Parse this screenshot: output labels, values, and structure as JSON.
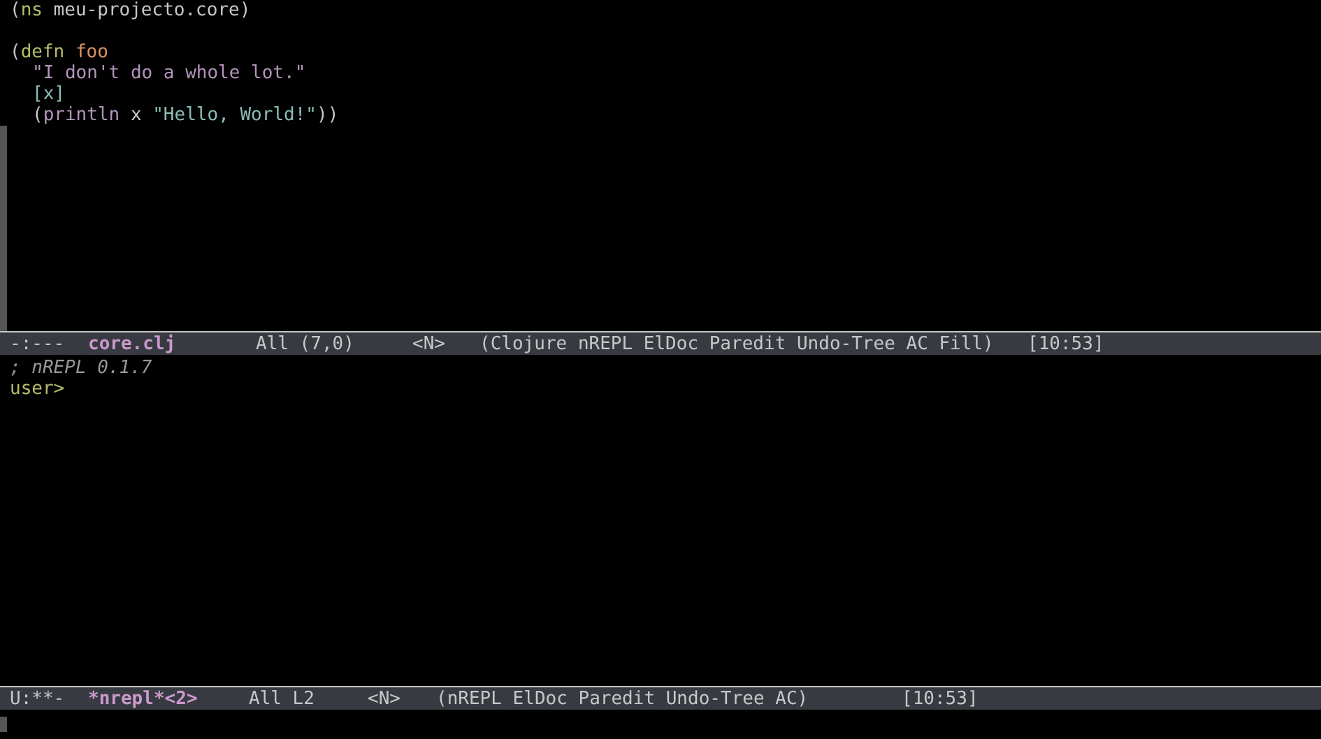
{
  "editor_window": {
    "lines": [
      {
        "indented": false,
        "blank_before": false,
        "tokens": [
          {
            "kind": "paren",
            "text": "("
          },
          {
            "kind": "keyword",
            "text": "ns"
          },
          {
            "kind": "plain",
            "text": " meu-projecto.core"
          },
          {
            "kind": "paren",
            "text": ")"
          }
        ]
      },
      {
        "indented": false,
        "blank_before": true,
        "tokens": [
          {
            "kind": "paren",
            "text": "("
          },
          {
            "kind": "keyword",
            "text": "defn"
          },
          {
            "kind": "name",
            "text": " foo"
          }
        ]
      },
      {
        "indented": true,
        "blank_before": false,
        "tokens": [
          {
            "kind": "docstring",
            "text": "\"I don't do a whole lot.\""
          }
        ]
      },
      {
        "indented": true,
        "blank_before": false,
        "tokens": [
          {
            "kind": "vector",
            "text": "[x]"
          }
        ]
      },
      {
        "indented": true,
        "blank_before": false,
        "tokens": [
          {
            "kind": "paren",
            "text": "("
          },
          {
            "kind": "docstring",
            "text": "println"
          },
          {
            "kind": "plain",
            "text": " x "
          },
          {
            "kind": "string",
            "text": "\"Hello, World!\""
          },
          {
            "kind": "paren",
            "text": "))"
          }
        ]
      }
    ]
  },
  "editor_mode_line": {
    "status": "-:---",
    "buffer": "core.clj",
    "position": "All (7,0)",
    "state": "<N>",
    "modes": "(Clojure nREPL ElDoc Paredit Undo-Tree AC Fill)",
    "time": "[10:53]"
  },
  "repl_window": {
    "comment": "; nREPL 0.1.7",
    "prompt": "user>"
  },
  "repl_mode_line": {
    "status": "U:**-",
    "buffer": "*nrepl*<2>",
    "position": "All L2",
    "state": "<N>",
    "modes": "(nREPL ElDoc Paredit Undo-Tree AC)",
    "time": "[10:53]"
  }
}
